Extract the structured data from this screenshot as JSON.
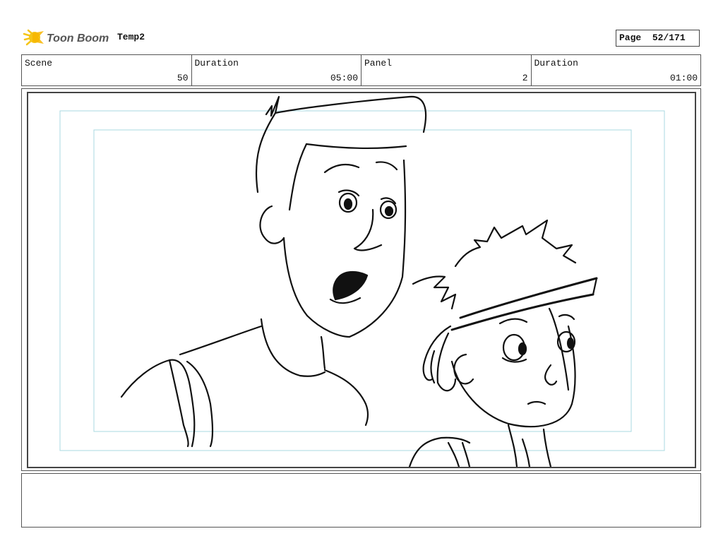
{
  "header": {
    "logo_text": "Toon Boom",
    "project_title": "Temp2",
    "page_label": "Page",
    "page_value": "52/171"
  },
  "info": [
    {
      "label": "Scene",
      "value": "50"
    },
    {
      "label": "Duration",
      "value": "05:00"
    },
    {
      "label": "Panel",
      "value": "2"
    },
    {
      "label": "Duration",
      "value": "01:00"
    }
  ],
  "colors": {
    "logo_accent": "#f5c518",
    "safe_frame": "#a8d8e0",
    "border": "#555555"
  },
  "notes": {
    "text": ""
  }
}
